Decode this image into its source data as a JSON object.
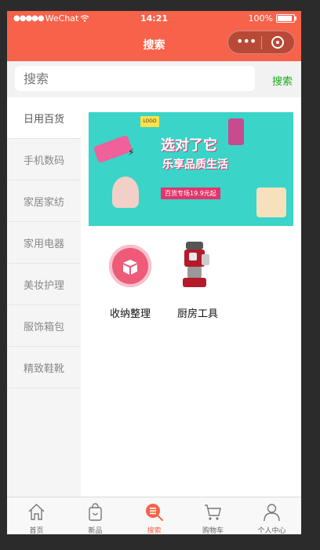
{
  "status_bar": {
    "signal_dots": "●●●●●",
    "carrier": "WeChat",
    "wifi_icon": "wifi-icon",
    "time": "14:21",
    "battery_text": "100%",
    "battery_level": 1.0
  },
  "nav": {
    "title": "搜索",
    "capsule_more": "•••",
    "brand_color": "#f7624a"
  },
  "search": {
    "placeholder": "搜索",
    "value": "",
    "button_label": "搜索",
    "button_color": "#1aad19"
  },
  "categories": {
    "active_index": 0,
    "items": [
      {
        "label": "日用百货"
      },
      {
        "label": "手机数码"
      },
      {
        "label": "家居家纺"
      },
      {
        "label": "家用电器"
      },
      {
        "label": "美妆护理"
      },
      {
        "label": "服饰箱包"
      },
      {
        "label": "精致鞋靴"
      }
    ]
  },
  "banner": {
    "logo": "LOGO",
    "headline": "选对了它",
    "subline": "乐享品质生活",
    "promo": "百货专场19.9元起"
  },
  "products": [
    {
      "label": "收纳整理",
      "icon": "storage-box-icon"
    },
    {
      "label": "厨房工具",
      "icon": "kitchen-mixer-icon"
    }
  ],
  "tabbar": {
    "active_index": 2,
    "items": [
      {
        "label": "首页",
        "icon": "home-icon"
      },
      {
        "label": "新品",
        "icon": "shopping-bag-icon"
      },
      {
        "label": "搜索",
        "icon": "search-list-icon"
      },
      {
        "label": "购物车",
        "icon": "cart-icon"
      },
      {
        "label": "个人中心",
        "icon": "user-icon"
      }
    ]
  }
}
